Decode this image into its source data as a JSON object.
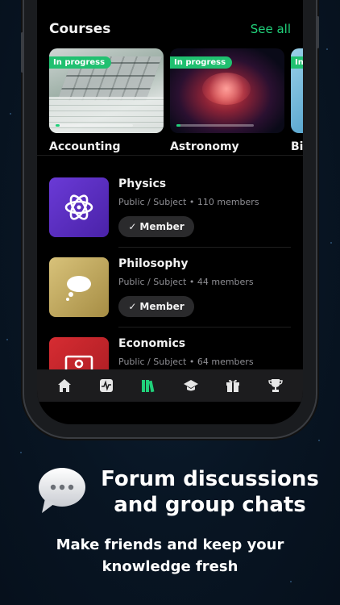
{
  "courses": {
    "title": "Courses",
    "see_all": "See all",
    "items": [
      {
        "name": "Accounting",
        "badge": "In progress",
        "progress": 0.05
      },
      {
        "name": "Astronomy",
        "badge": "In progress",
        "progress": 0.05
      },
      {
        "name": "Bi",
        "badge": "In",
        "progress": 0.0
      }
    ]
  },
  "groups": [
    {
      "name": "Physics",
      "meta": "Public / Subject  •  110 members",
      "button": "Member",
      "icon": "atom-icon",
      "color": "#5b2fc4"
    },
    {
      "name": "Philosophy",
      "meta": "Public / Subject  •  44 members",
      "button": "Member",
      "icon": "thought-bubble-icon",
      "color": "#b9a35a"
    },
    {
      "name": "Economics",
      "meta": "Public / Subject  •  64 members",
      "button": "Member",
      "icon": "money-icon",
      "color": "#c4242a"
    }
  ],
  "tabbar": {
    "items": [
      {
        "icon": "home-icon",
        "active": false
      },
      {
        "icon": "activity-icon",
        "active": false
      },
      {
        "icon": "library-books-icon",
        "active": true
      },
      {
        "icon": "graduation-cap-icon",
        "active": false
      },
      {
        "icon": "gift-icon",
        "active": false
      },
      {
        "icon": "trophy-icon",
        "active": false
      }
    ],
    "active_color": "#20d07a"
  },
  "promo": {
    "icon": "speech-bubble-icon",
    "headline_line1": "Forum discussions",
    "headline_line2": "and group chats",
    "subline_line1": "Make friends and keep your",
    "subline_line2": "knowledge fresh"
  }
}
